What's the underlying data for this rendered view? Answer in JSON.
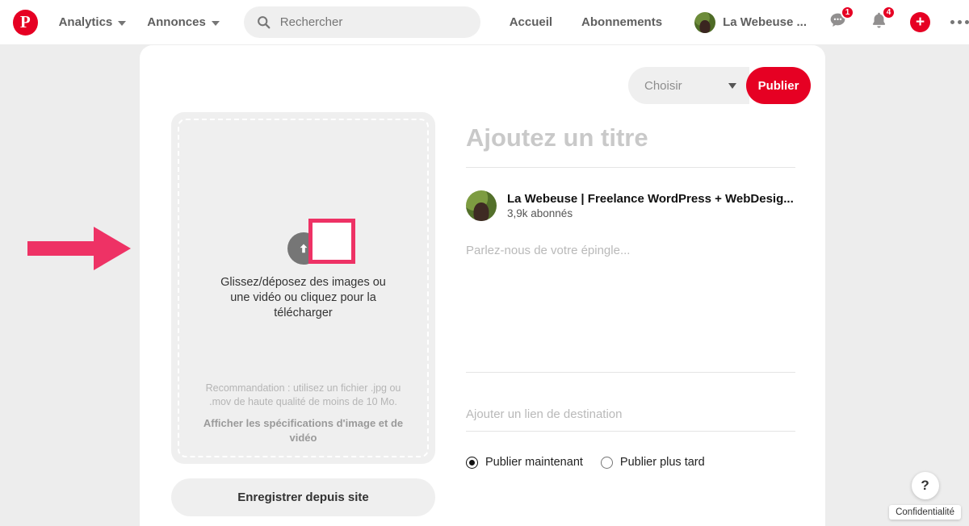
{
  "header": {
    "logo_icon": "pinterest-logo-icon",
    "logo_letter": "P",
    "menus": [
      {
        "label": "Analytics",
        "icon": "chevron-down-icon"
      },
      {
        "label": "Annonces",
        "icon": "chevron-down-icon"
      }
    ],
    "search": {
      "icon": "search-icon",
      "placeholder": "Rechercher",
      "value": ""
    },
    "links": [
      {
        "label": "Accueil"
      },
      {
        "label": "Abonnements"
      }
    ],
    "account": {
      "name": "La Webeuse ...",
      "avatar_icon": "avatar-icon"
    },
    "messages": {
      "icon": "message-bubble-icon",
      "badge": "1"
    },
    "notifications": {
      "icon": "bell-icon",
      "badge": "4"
    },
    "create": {
      "icon": "plus-icon",
      "glyph": "+"
    },
    "more": {
      "icon": "more-horizontal-icon"
    }
  },
  "publish_bar": {
    "board_select": {
      "value": "Choisir",
      "icon": "chevron-down-icon"
    },
    "publish_label": "Publier"
  },
  "upload": {
    "icon": "upload-arrow-icon",
    "caption": "Glissez/déposez des images ou une vidéo ou cliquez pour la télécharger",
    "recommendation": "Recommandation : utilisez un fichier .jpg ou .mov de haute qualité de moins de 10 Mo.",
    "specs_link": "Afficher les spécifications d'image et de vidéo",
    "save_from_site_label": "Enregistrer depuis site"
  },
  "annotation": {
    "arrow_icon": "pointer-arrow-icon",
    "highlight_icon": "highlight-box-icon",
    "color": "#ee3265"
  },
  "pin_form": {
    "title": {
      "placeholder": "Ajoutez un titre",
      "value": ""
    },
    "board": {
      "name": "La Webeuse | Freelance WordPress + WebDesig...",
      "followers": "3,9k abonnés",
      "avatar_icon": "avatar-icon"
    },
    "description": {
      "placeholder": "Parlez-nous de votre épingle...",
      "value": ""
    },
    "link": {
      "placeholder": "Ajouter un lien de destination",
      "value": ""
    },
    "schedule": {
      "options": [
        {
          "label": "Publier maintenant",
          "selected": true
        },
        {
          "label": "Publier plus tard",
          "selected": false
        }
      ]
    }
  },
  "privacy": {
    "help_icon": "question-mark-icon",
    "help_glyph": "?",
    "label": "Confidentialité"
  },
  "colors": {
    "brand_red": "#e60023",
    "annotation_pink": "#ee3265",
    "page_bg": "#ededed",
    "field_bg": "#efefef"
  }
}
